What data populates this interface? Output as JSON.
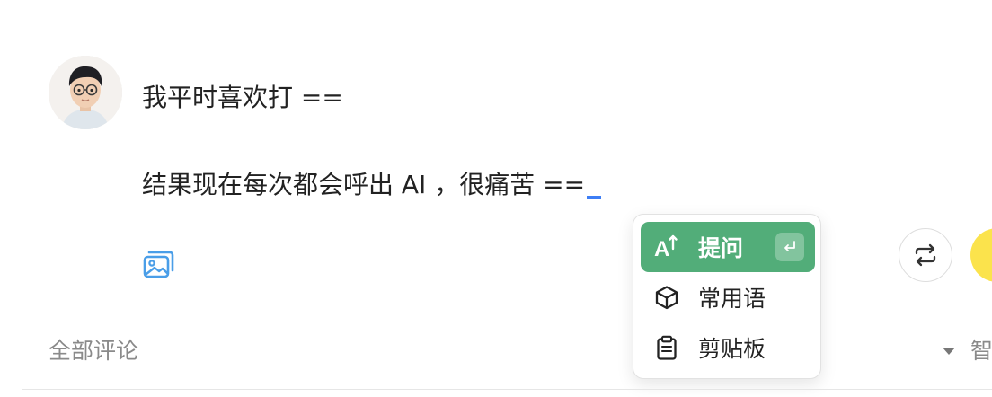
{
  "message": {
    "line1": "我平时喜欢打 ==",
    "line2": "结果现在每次都会呼出 AI ，很痛苦 =="
  },
  "popup_menu": {
    "items": [
      {
        "label": "提问",
        "icon": "ai-sparkle-icon",
        "shortcut_icon": "enter-key-icon",
        "active": true
      },
      {
        "label": "常用语",
        "icon": "cube-icon",
        "active": false
      },
      {
        "label": "剪贴板",
        "icon": "clipboard-icon",
        "active": false
      }
    ],
    "ai_icon_text": "A"
  },
  "comments": {
    "label": "全部评论",
    "sort_label": "智",
    "sort_icon": "triangle-down-icon"
  },
  "colors": {
    "accent_green": "#52ad79",
    "caret_blue": "#3d7ef5",
    "image_icon_blue": "#4a9ee8",
    "yellow_button": "#fbe34c",
    "muted_text": "#8a8a8a"
  }
}
